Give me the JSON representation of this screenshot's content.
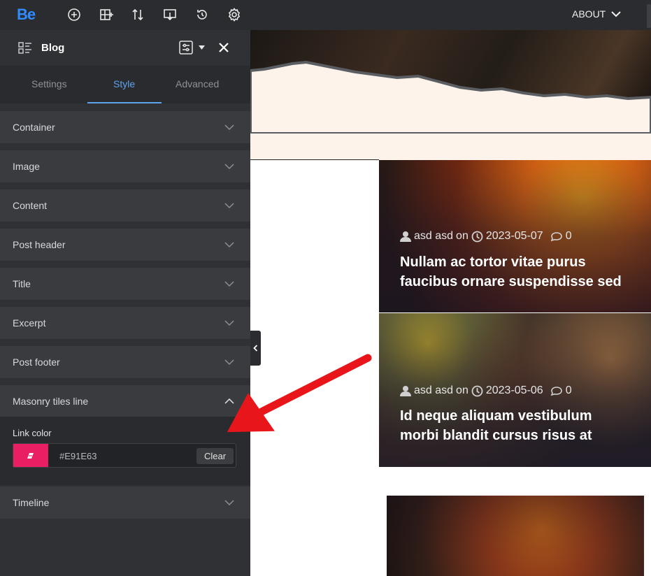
{
  "topbar": {
    "logo": "Be",
    "about_label": "ABOUT",
    "icons": [
      "add-icon",
      "layout-add-icon",
      "sort-icon",
      "export-icon",
      "history-icon",
      "settings-icon"
    ]
  },
  "panel": {
    "title": "Blog",
    "tabs": [
      {
        "label": "Settings",
        "active": false
      },
      {
        "label": "Style",
        "active": true
      },
      {
        "label": "Advanced",
        "active": false
      }
    ],
    "sections": [
      {
        "label": "Container",
        "expanded": false
      },
      {
        "label": "Image",
        "expanded": false
      },
      {
        "label": "Content",
        "expanded": false
      },
      {
        "label": "Post header",
        "expanded": false
      },
      {
        "label": "Title",
        "expanded": false
      },
      {
        "label": "Excerpt",
        "expanded": false
      },
      {
        "label": "Post footer",
        "expanded": false
      },
      {
        "label": "Masonry tiles line",
        "expanded": true
      },
      {
        "label": "Timeline",
        "expanded": false
      }
    ],
    "link_color": {
      "label": "Link color",
      "value": "#E91E63",
      "clear_label": "Clear",
      "swatch_color": "#e91e63"
    }
  },
  "posts": [
    {
      "author": "asd asd",
      "on": "on",
      "date": "2023-05-07",
      "comments": "0",
      "title": "Nullam ac tortor vitae purus faucibus ornare suspendisse sed"
    },
    {
      "author": "asd asd",
      "on": "on",
      "date": "2023-05-06",
      "comments": "0",
      "title": "Id neque aliquam vestibulum morbi blandit cursus risus at"
    }
  ],
  "colors": {
    "accent": "#5ea2f0",
    "brand": "#2f8cff",
    "arrow": "#e8161b"
  }
}
